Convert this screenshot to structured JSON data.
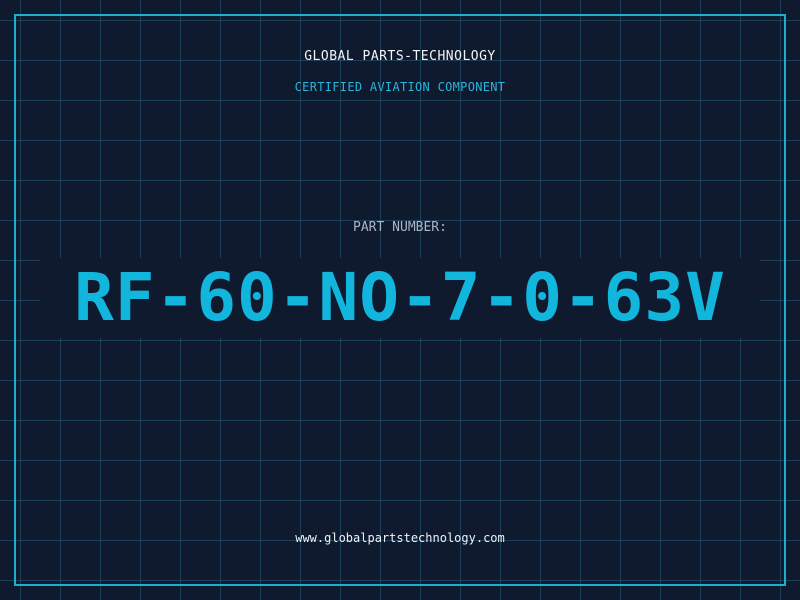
{
  "header": {
    "company": "GLOBAL PARTS-TECHNOLOGY",
    "subtitle": "CERTIFIED AVIATION COMPONENT"
  },
  "part": {
    "label": "PART NUMBER:",
    "number": "RF-60-NO-7-0-63V"
  },
  "footer": {
    "website": "www.globalpartstechnology.com"
  },
  "colors": {
    "background": "#101a2e",
    "grid": "#2d6e8c",
    "frame": "#1faed0",
    "accent": "#12b6dd",
    "title_text": "#f2f4f8",
    "label_text": "#a9b6c8"
  }
}
